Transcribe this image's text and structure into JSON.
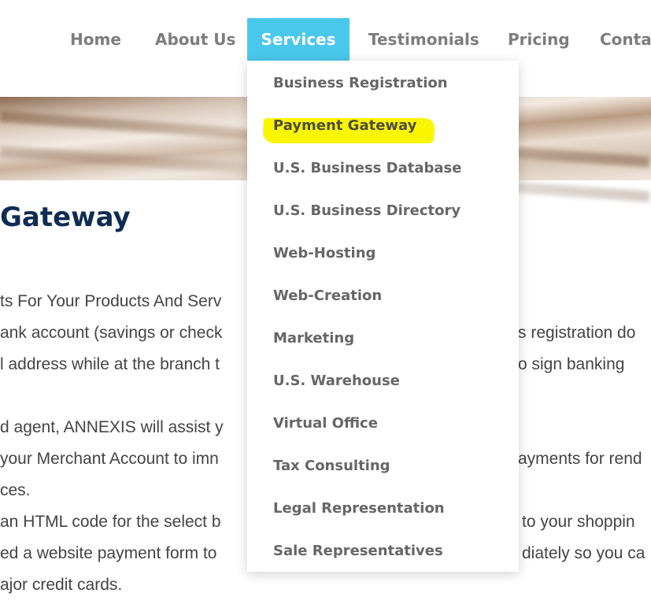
{
  "nav": {
    "items": [
      {
        "label": "Home"
      },
      {
        "label": "About Us"
      },
      {
        "label": "Services"
      },
      {
        "label": "Testimonials"
      },
      {
        "label": "Pricing"
      },
      {
        "label": "Contac"
      }
    ]
  },
  "dropdown": {
    "items": [
      {
        "label": "Business Registration"
      },
      {
        "label": "Payment Gateway"
      },
      {
        "label": "U.S. Business Database"
      },
      {
        "label": "U.S. Business Directory"
      },
      {
        "label": "Web-Hosting"
      },
      {
        "label": "Web-Creation"
      },
      {
        "label": "Marketing"
      },
      {
        "label": "U.S. Warehouse"
      },
      {
        "label": "Virtual Office"
      },
      {
        "label": "Tax Consulting"
      },
      {
        "label": "Legal Representation"
      },
      {
        "label": "Sale Representatives"
      }
    ]
  },
  "page": {
    "title": "Gateway",
    "lines": [
      {
        "left": "ts For Your Products And Serv",
        "right": ""
      },
      {
        "left": "ank account (savings or check",
        "right": "s registration do"
      },
      {
        "left": "l address while at the branch t",
        "right": "o sign banking"
      },
      {
        "left": "d agent, ANNEXIS will assist y",
        "right": ""
      },
      {
        "left": "your Merchant Account to imn",
        "right": "ayments for rend"
      },
      {
        "left": "ces.",
        "right": ""
      },
      {
        "left": "an HTML code for the select b",
        "right": "to your shoppin"
      },
      {
        "left": "ed a website payment form to",
        "right": "diately so you ca"
      },
      {
        "left": "ajor credit cards.",
        "right": ""
      }
    ]
  },
  "colors": {
    "nav_active_bg": "#4ac8ec",
    "highlight": "#faf500",
    "title": "#0f2c52"
  }
}
